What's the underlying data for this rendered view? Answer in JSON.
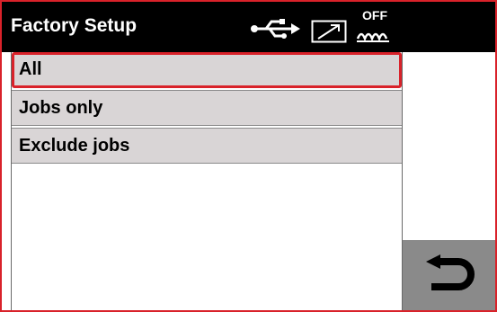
{
  "header": {
    "title": "Factory Setup",
    "status_icons": [
      "usb-icon",
      "trend-icon",
      "heater-off-icon"
    ],
    "heater_status_text": "OFF"
  },
  "menu": {
    "items": [
      {
        "label": "All",
        "selected": true
      },
      {
        "label": "Jobs only",
        "selected": false
      },
      {
        "label": "Exclude jobs",
        "selected": false
      }
    ]
  },
  "back_button": {
    "icon": "return-arrow-icon"
  },
  "colors": {
    "header_background": "#000000",
    "selection_outline": "#d9222a",
    "menu_item_background": "#d9d5d6",
    "back_button_background": "#8a8a8a"
  }
}
